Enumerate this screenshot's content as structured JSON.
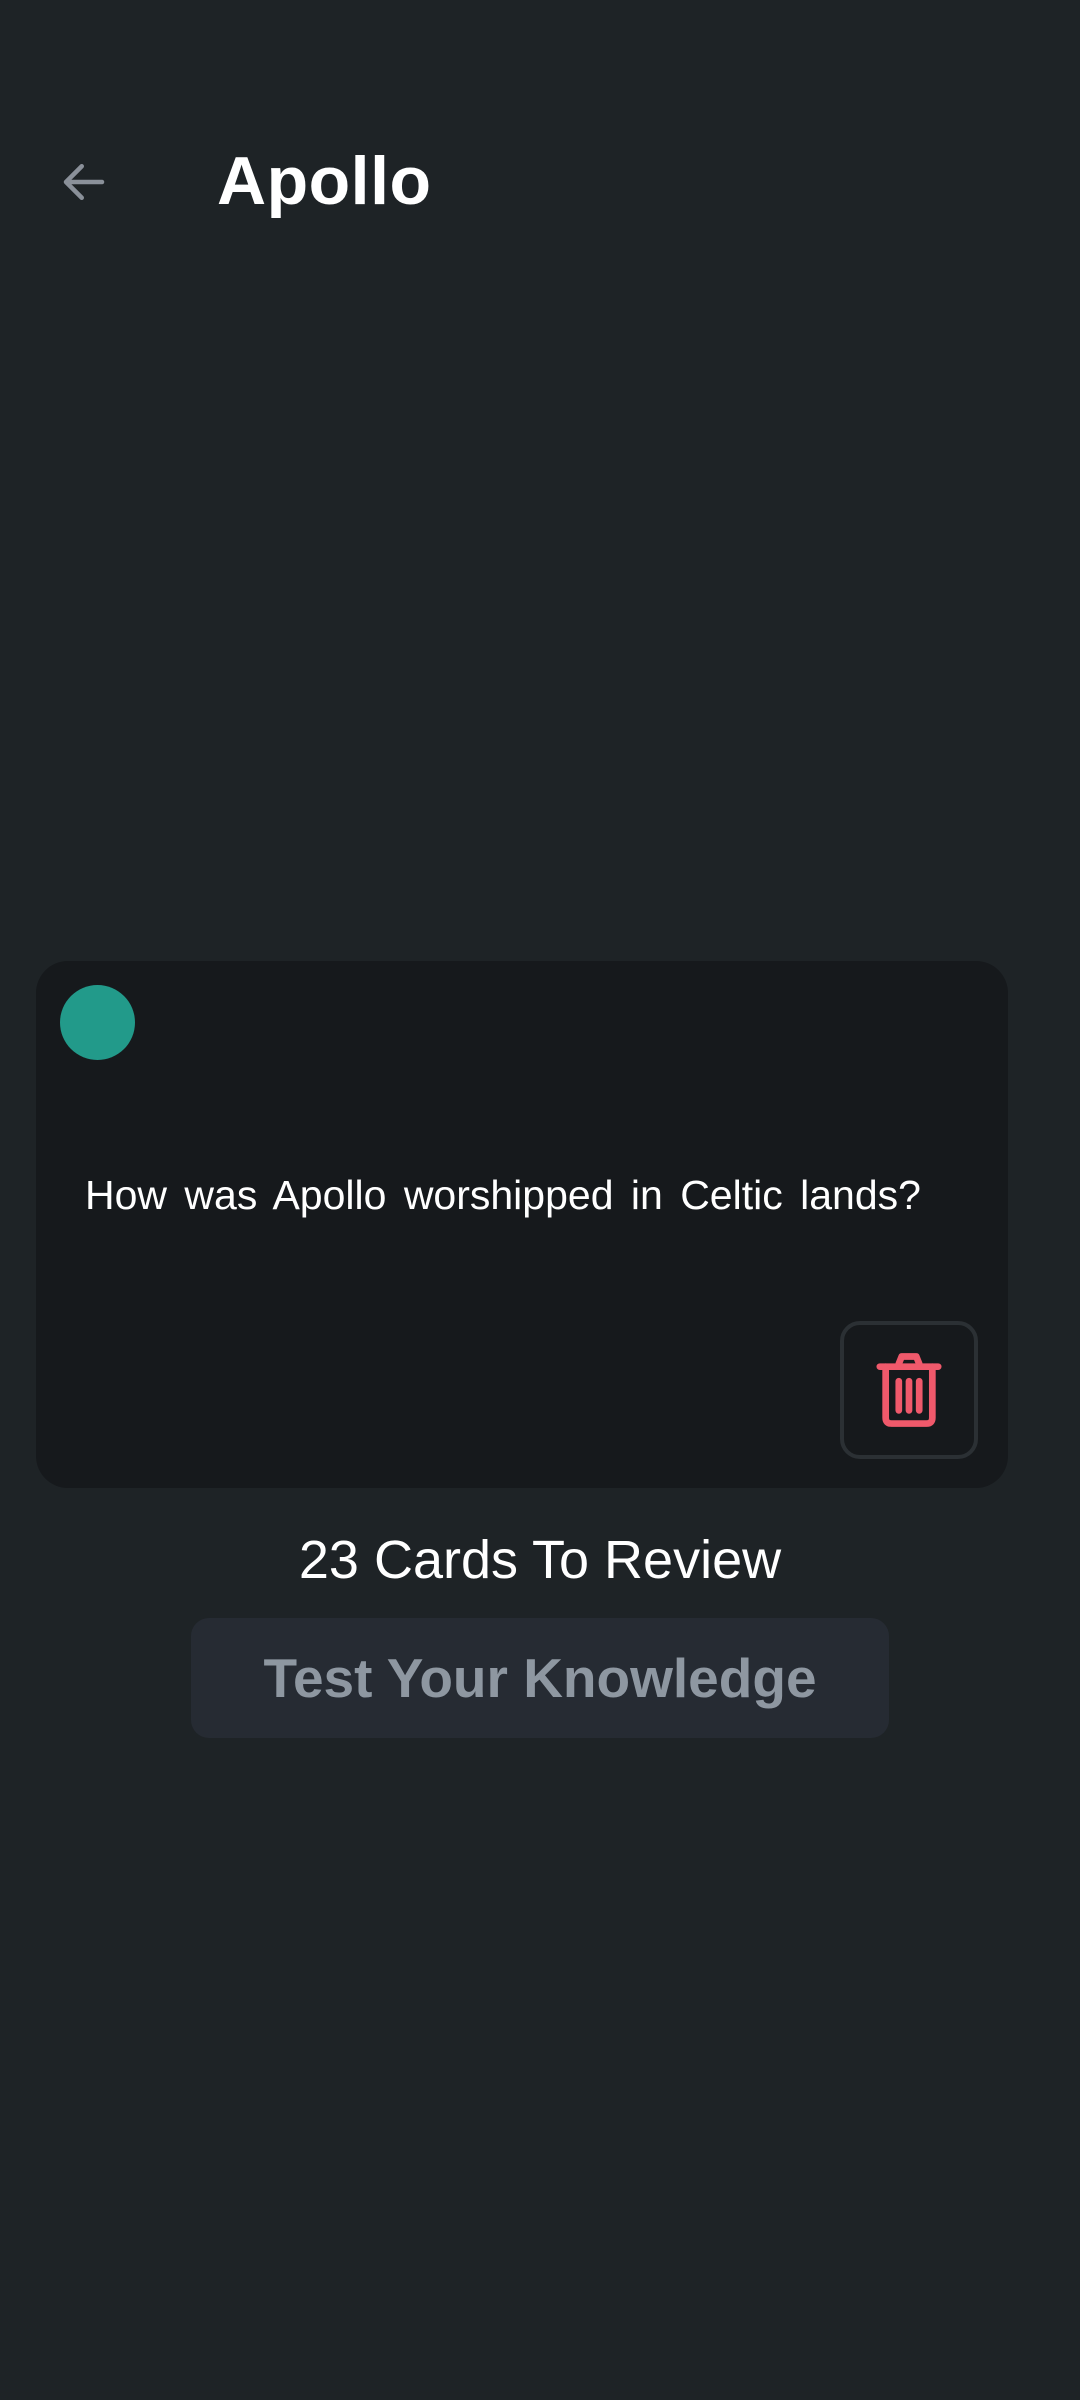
{
  "header": {
    "back_icon": "arrow-left-icon",
    "title": "Apollo"
  },
  "card": {
    "indicator_color": "#229a8a",
    "question": "How was Apollo worshipped in Celtic lands?",
    "delete_icon": "trash-icon",
    "delete_color": "#f0596b"
  },
  "review": {
    "count_text": "23 Cards To Review",
    "button_label": "Test Your Knowledge"
  }
}
